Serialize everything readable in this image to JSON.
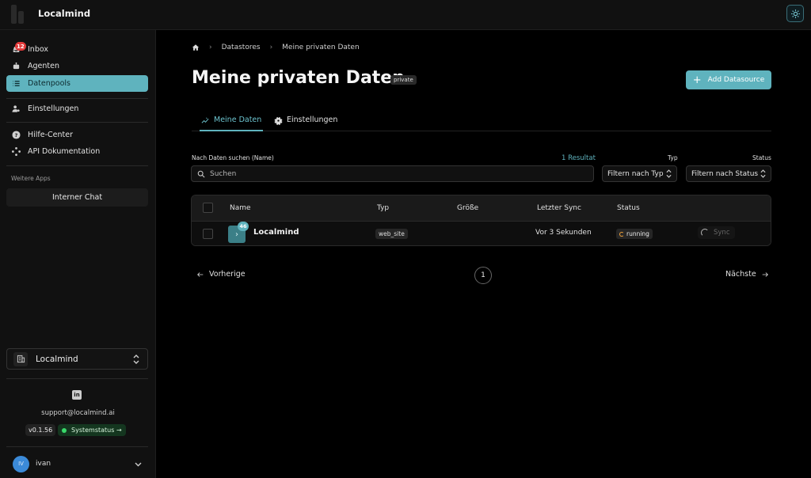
{
  "app": {
    "title": "Localmind",
    "accent": "#5fb3be"
  },
  "topbar": {
    "theme_icon": "sun-icon"
  },
  "sidebar": {
    "items": [
      {
        "label": "Inbox",
        "icon": "inbox-icon",
        "badge": "12"
      },
      {
        "label": "Agenten",
        "icon": "robot-icon"
      },
      {
        "label": "Datenpools",
        "icon": "list-icon",
        "active": true
      },
      {
        "label": "Einstellungen",
        "icon": "user-settings-icon"
      },
      {
        "label": "Hilfe-Center",
        "icon": "help-icon"
      },
      {
        "label": "API Dokumentation",
        "icon": "api-icon"
      }
    ],
    "section_label": "Weitere Apps",
    "chat_button": "Interner Chat",
    "org_select": "Localmind",
    "support_email": "support@localmind.ai",
    "version": "v0.1.56",
    "system_status": "Systemstatus →",
    "user": {
      "initials": "IV",
      "name": "ivan"
    }
  },
  "breadcrumb": {
    "items": [
      "Datastores",
      "Meine privaten Daten"
    ]
  },
  "page": {
    "title": "Meine privaten Daten",
    "tag": "private",
    "add_button": "Add Datasource"
  },
  "tabs": [
    {
      "label": "Meine Daten",
      "active": true
    },
    {
      "label": "Einstellungen"
    }
  ],
  "filters": {
    "search_label": "Nach Daten suchen (Name)",
    "result_count": "1 Resultat",
    "search_placeholder": "Suchen",
    "type_label": "Typ",
    "type_value": "Filtern nach Typ",
    "status_label": "Status",
    "status_value": "Filtern nach Status"
  },
  "table": {
    "headers": [
      "Name",
      "Typ",
      "Größe",
      "Letzter Sync",
      "Status"
    ],
    "rows": [
      {
        "name": "Localmind",
        "count": "46",
        "type": "web_site",
        "size": "",
        "last_sync": "Vor 3 Sekunden",
        "status": "running",
        "action": "Sync"
      }
    ]
  },
  "pagination": {
    "prev": "Vorherige",
    "page": "1",
    "next": "Nächste"
  }
}
